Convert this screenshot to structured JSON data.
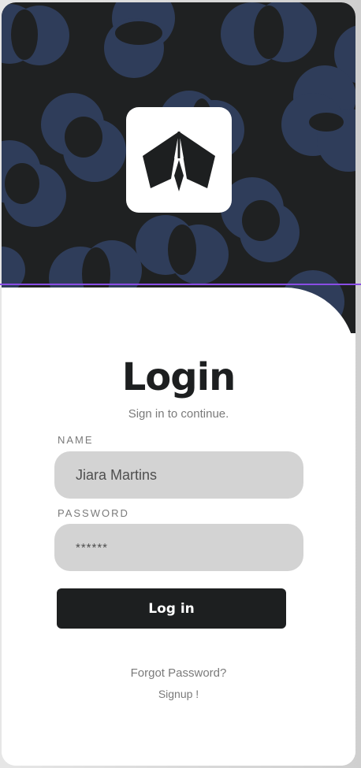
{
  "colors": {
    "hero_background": "#1f2122",
    "bubble": "#2f3d5a",
    "accent_line": "#8a4de6",
    "button_bg": "#1d1f20",
    "field_bg": "#d3d3d3"
  },
  "brand": {
    "logo_icon": "paper-plane-icon"
  },
  "login": {
    "title": "Login",
    "subtitle": "Sign in to continue."
  },
  "form": {
    "name_label": "NAME",
    "name_value": "Jiara Martins",
    "password_label": "PASSWORD",
    "password_value": "******",
    "submit_label": "Log in"
  },
  "links": {
    "forgot": "Forgot Password?",
    "signup": "Signup !"
  }
}
